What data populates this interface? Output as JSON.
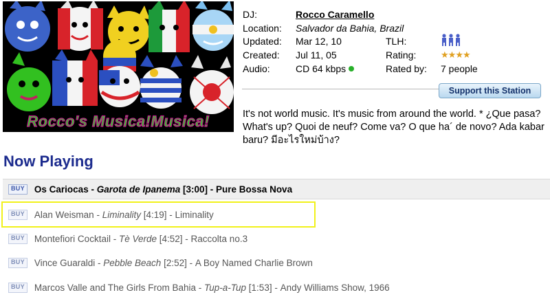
{
  "logo": {
    "text": "Rocco's Musica!Musica!"
  },
  "info": {
    "dj_label": "DJ:",
    "dj_name": "Rocco Caramello",
    "location_label": "Location:",
    "location_value": "Salvador da Bahia, Brazil",
    "updated_label": "Updated:",
    "updated_value": "Mar 12, 10",
    "created_label": "Created:",
    "created_value": "Jul 11, 05",
    "audio_label": "Audio:",
    "audio_value": "CD 64 kbps",
    "tlh_label": "TLH:",
    "rating_label": "Rating:",
    "rating_stars": 4,
    "rated_by_label": "Rated by:",
    "rated_by_value": "7 people"
  },
  "support_button": "Support this Station",
  "description": "It's not world music. It's music from around the world. * ¿Que pasa? What's up? Quoi de neuf? Come va? O que ha´ de novo? Ada kabar baru? มีอะไรใหม่บ้าง?",
  "now_playing_title": "Now Playing",
  "buy_label": "BUY",
  "tracks": [
    {
      "artist": "Os Cariocas",
      "song": "Garota de Ipanema",
      "duration": "[3:00]",
      "album": "Pure Bossa Nova"
    },
    {
      "artist": "Alan Weisman",
      "song": "Liminality",
      "duration": "[4:19]",
      "album": "Liminality"
    },
    {
      "artist": "Montefiori Cocktail",
      "song": "Tè Verde",
      "duration": "[4:52]",
      "album": "Raccolta no.3"
    },
    {
      "artist": "Vince Guaraldi",
      "song": "Pebble Beach",
      "duration": "[2:52]",
      "album": "A Boy Named Charlie Brown"
    },
    {
      "artist": "Marcos Valle and The Girls From Bahia",
      "song": "Tup-a-Tup",
      "duration": "[1:53]",
      "album": "Andy Williams Show, 1966"
    }
  ],
  "colors": {
    "title_blue": "#1c2b8e",
    "online_dot": "#28b02a",
    "highlight": "#f1f11a",
    "star": "#e0a020",
    "tlh_icon": "#4a5fc8"
  }
}
